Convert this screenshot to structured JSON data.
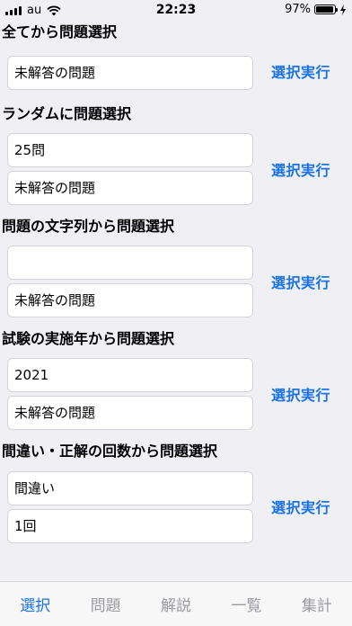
{
  "status_bar": {
    "carrier": "au",
    "time": "22:23",
    "battery_percent_text": "97%",
    "battery_level": 0.97
  },
  "sections": [
    {
      "title": "全てから問題選択",
      "fields": [
        "未解答の問題"
      ],
      "button": "選択実行"
    },
    {
      "title": "ランダムに問題選択",
      "fields": [
        "25問",
        "未解答の問題"
      ],
      "button": "選択実行"
    },
    {
      "title": "問題の文字列から問題選択",
      "fields": [
        "",
        "未解答の問題"
      ],
      "button": "選択実行"
    },
    {
      "title": "試験の実施年から問題選択",
      "fields": [
        "2021",
        "未解答の問題"
      ],
      "button": "選択実行"
    },
    {
      "title": "間違い・正解の回数から問題選択",
      "fields": [
        "間違い",
        "1回"
      ],
      "button": "選択実行"
    }
  ],
  "tabs": [
    {
      "label": "選択",
      "active": true
    },
    {
      "label": "問題",
      "active": false
    },
    {
      "label": "解説",
      "active": false
    },
    {
      "label": "一覧",
      "active": false
    },
    {
      "label": "集計",
      "active": false
    }
  ],
  "colors": {
    "accent": "#1a73e8",
    "inactive_tab": "#9a9a9f",
    "background": "#efeff4"
  }
}
